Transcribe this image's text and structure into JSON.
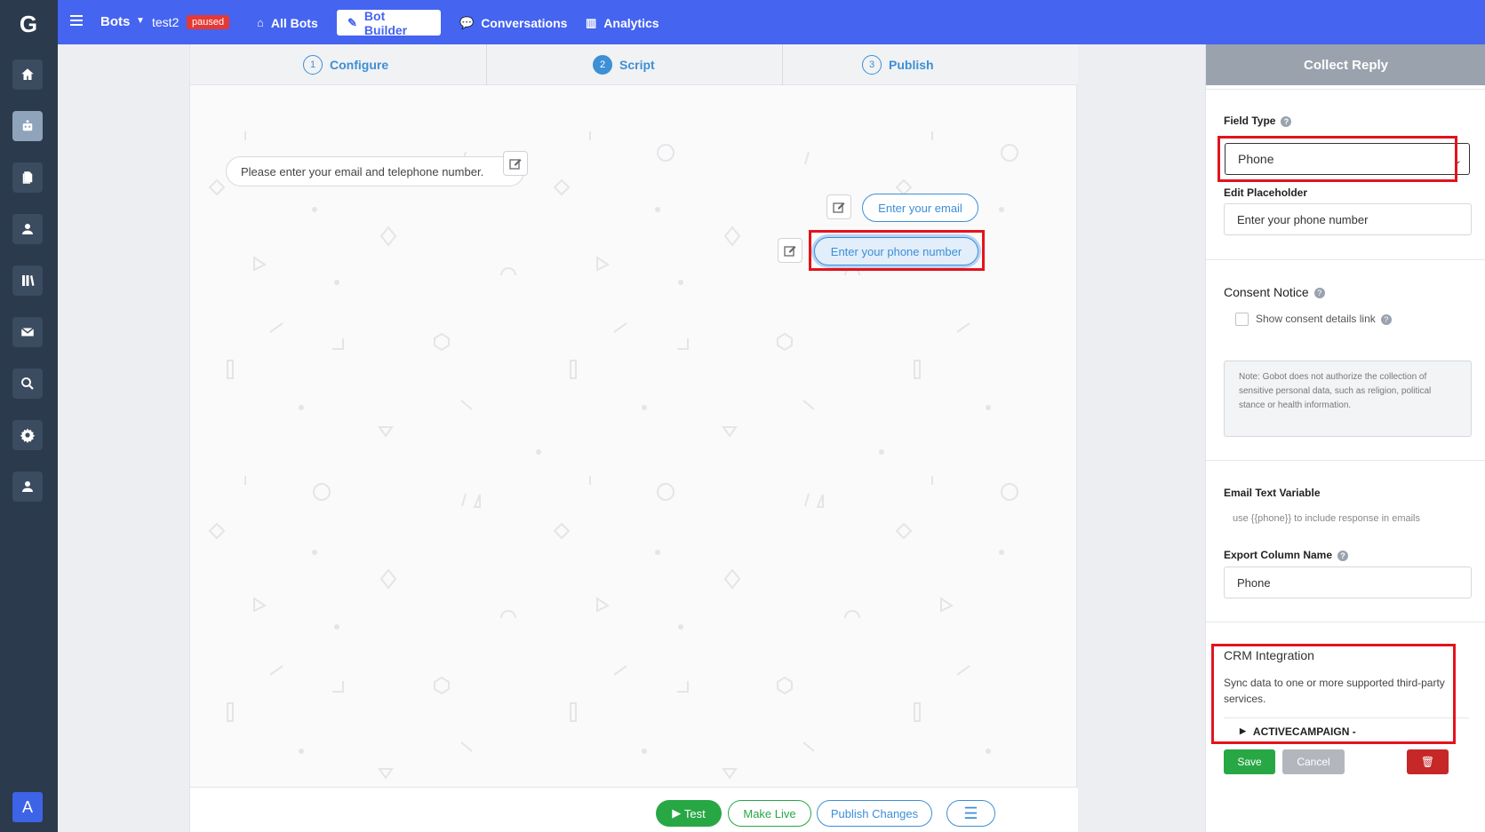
{
  "topbar": {
    "bots_label": "Bots",
    "bot_name": "test2",
    "status_badge": "paused",
    "tabs": [
      {
        "label": "All Bots",
        "icon": "home-icon"
      },
      {
        "label": "Bot Builder",
        "icon": "pencil-icon"
      },
      {
        "label": "Conversations",
        "icon": "chat-icon"
      },
      {
        "label": "Analytics",
        "icon": "bar-chart-icon"
      }
    ],
    "active_tab": "Bot Builder"
  },
  "leftnav": {
    "items": [
      "home-icon",
      "robot-icon",
      "documents-icon",
      "user-icon",
      "library-icon",
      "mail-icon",
      "search-icon",
      "gear-icon",
      "account-icon"
    ],
    "avatar": "A"
  },
  "steps": [
    {
      "num": "1",
      "label": "Configure"
    },
    {
      "num": "2",
      "label": "Script"
    },
    {
      "num": "3",
      "label": "Publish"
    }
  ],
  "script": {
    "bot_message": "Please enter your email and telephone number.",
    "reply_email": "Enter your email",
    "reply_phone": "Enter your phone number"
  },
  "footer": {
    "test": "Test",
    "make_live": "Make Live",
    "publish_changes": "Publish Changes"
  },
  "panel": {
    "title": "Collect Reply",
    "field_type_label": "Field Type",
    "field_type_value": "Phone",
    "edit_placeholder_label": "Edit Placeholder",
    "edit_placeholder_value": "Enter your phone number",
    "consent_notice_label": "Consent Notice",
    "show_consent_label": "Show consent details link",
    "note": "Note: Gobot does not authorize the collection of sensitive personal data, such as religion, political stance or health information.",
    "email_text_variable_label": "Email Text Variable",
    "email_text_variable_hint": "use {{phone}} to include response in emails",
    "export_column_label": "Export Column Name",
    "export_column_value": "Phone",
    "crm_title": "CRM Integration",
    "crm_desc": "Sync data to one or more supported third-party services.",
    "crm_item": "ACTIVECAMPAIGN -",
    "save": "Save",
    "cancel": "Cancel"
  },
  "colors": {
    "topbar": "#4564f0",
    "leftnav": "#2b3a4d",
    "accent_blue": "#3d8fd6",
    "green": "#28a745",
    "highlight_red": "#e3131c"
  }
}
